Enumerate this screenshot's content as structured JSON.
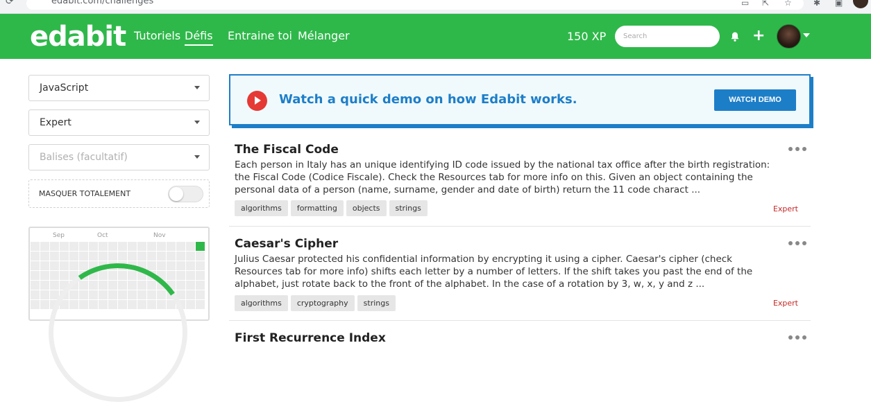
{
  "browser": {
    "url": "edabit.com/challenges"
  },
  "nav": {
    "logo": "edabit",
    "links": [
      "Tutoriels",
      "Défis",
      "Entraine toi",
      "Mélanger"
    ],
    "active_link": "Défis",
    "xp": "150 XP",
    "search_placeholder": "Search",
    "icons": [
      "bell-icon",
      "plus-icon",
      "avatar",
      "caret-down-icon"
    ],
    "colors": {
      "nav_bg": "#2fb84a"
    }
  },
  "sidebar": {
    "language": "JavaScript",
    "difficulty": "Expert",
    "tags_placeholder": "Balises (facultatif)",
    "hide_label": "MASQUER TOTALEMENT",
    "hide_completed": false,
    "heatmap_months": [
      "Sep",
      "Oct",
      "Nov"
    ]
  },
  "banner": {
    "text": "Watch a quick demo on how Edabit works.",
    "button": "WATCH DEMO",
    "colors": {
      "accent": "#1d7ec8",
      "play": "#e53935"
    }
  },
  "challenges": [
    {
      "title": "The Fiscal Code",
      "description": "Each person in Italy has an unique identifying ID code issued by the national tax office after the birth registration: the Fiscal Code (Codice Fiscale). Check the Resources tab for more info on this. Given an object containing the personal data of a person (name, surname, gender and date of birth) return the 11 code charact ...",
      "tags": [
        "algorithms",
        "formatting",
        "objects",
        "strings"
      ],
      "level": "Expert"
    },
    {
      "title": "Caesar's Cipher",
      "description": "Julius Caesar protected his confidential information by encrypting it using a cipher. Caesar's cipher (check Resources tab for more info) shifts each letter by a number of letters. If the shift takes you past the end of the alphabet, just rotate back to the front of the alphabet. In the case of a rotation by 3, w, x, y and z ...",
      "tags": [
        "algorithms",
        "cryptography",
        "strings"
      ],
      "level": "Expert"
    },
    {
      "title": "First Recurrence Index",
      "description": "",
      "tags": [],
      "level": ""
    }
  ]
}
